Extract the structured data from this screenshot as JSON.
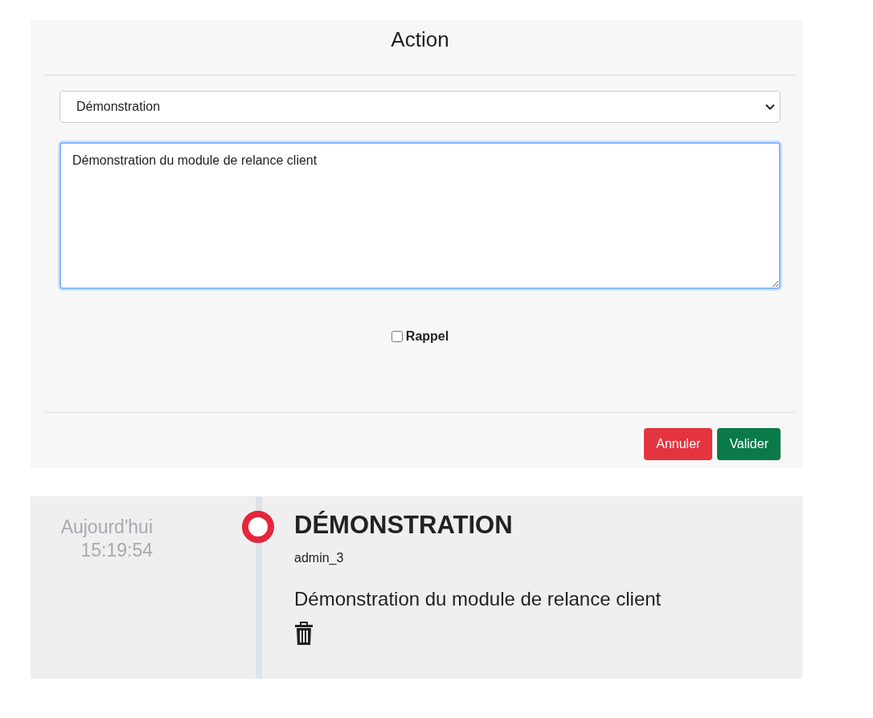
{
  "action_dialog": {
    "title": "Action",
    "action_type": {
      "value": "Démonstration"
    },
    "comment": {
      "value": "Démonstration du module de relance client"
    },
    "reminder": {
      "label": "Rappel",
      "checked": false
    },
    "buttons": [
      {
        "label": "Annuler",
        "kind": "cancel"
      },
      {
        "label": "Valider",
        "kind": "confirm"
      }
    ]
  },
  "timeline": [
    {
      "date": "Aujourd'hui",
      "time": "15:19:54",
      "title": "DÉMONSTRATION",
      "author": "admin_3",
      "description": "Démonstration du module de relance client"
    }
  ]
}
